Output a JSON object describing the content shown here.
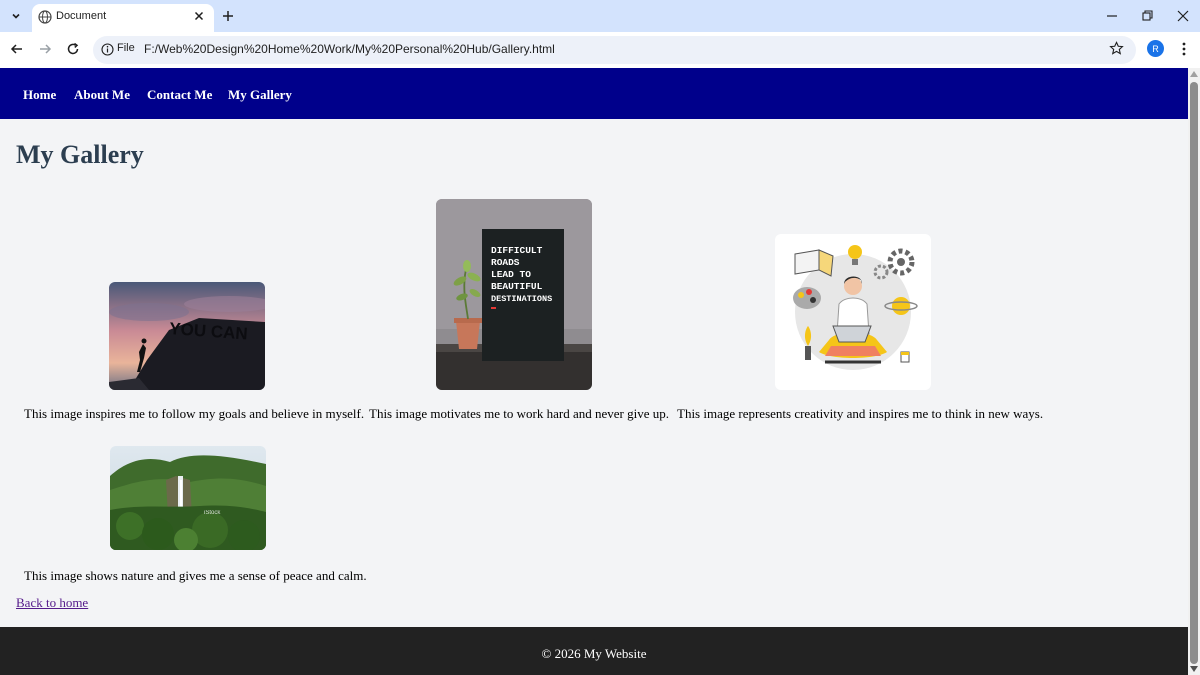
{
  "browser": {
    "tab_title": "Document",
    "file_chip": "File",
    "url": "F:/Web%20Design%20Home%20Work/My%20Personal%20Hub/Gallery.html",
    "avatar_letter": "R",
    "icons": [
      "tab-search-icon",
      "globe-icon",
      "close-icon",
      "plus-icon",
      "minimize-icon",
      "restore-icon",
      "window-close-icon",
      "back-arrow-icon",
      "forward-arrow-icon",
      "reload-icon",
      "info-icon",
      "star-icon",
      "kebab-menu-icon"
    ]
  },
  "nav": {
    "home": "Home",
    "about": "About Me",
    "contact": "Contact Me",
    "gallery": "My Gallery"
  },
  "page": {
    "title": "My Gallery",
    "back_link": "Back to home",
    "footer": "© 2026 My Website"
  },
  "gallery": [
    {
      "caption": "This image inspires me to follow my goals and believe in myself.",
      "image_text": "YOU CAN"
    },
    {
      "caption": "This image motivates me to work hard and never give up.",
      "image_text": "DIFFICULT ROADS LEAD TO BEAUTIFUL DESTINATIONS"
    },
    {
      "caption": "This image represents creativity and inspires me to think in new ways."
    },
    {
      "caption": "This image shows nature and gives me a sense of peace and calm.",
      "image_text": "iStock"
    }
  ],
  "colors": {
    "navbar": "#00008b",
    "footer": "#222222",
    "title": "#2c3e50",
    "page_bg": "#f3f4f6",
    "visited_link": "#551a8b"
  }
}
